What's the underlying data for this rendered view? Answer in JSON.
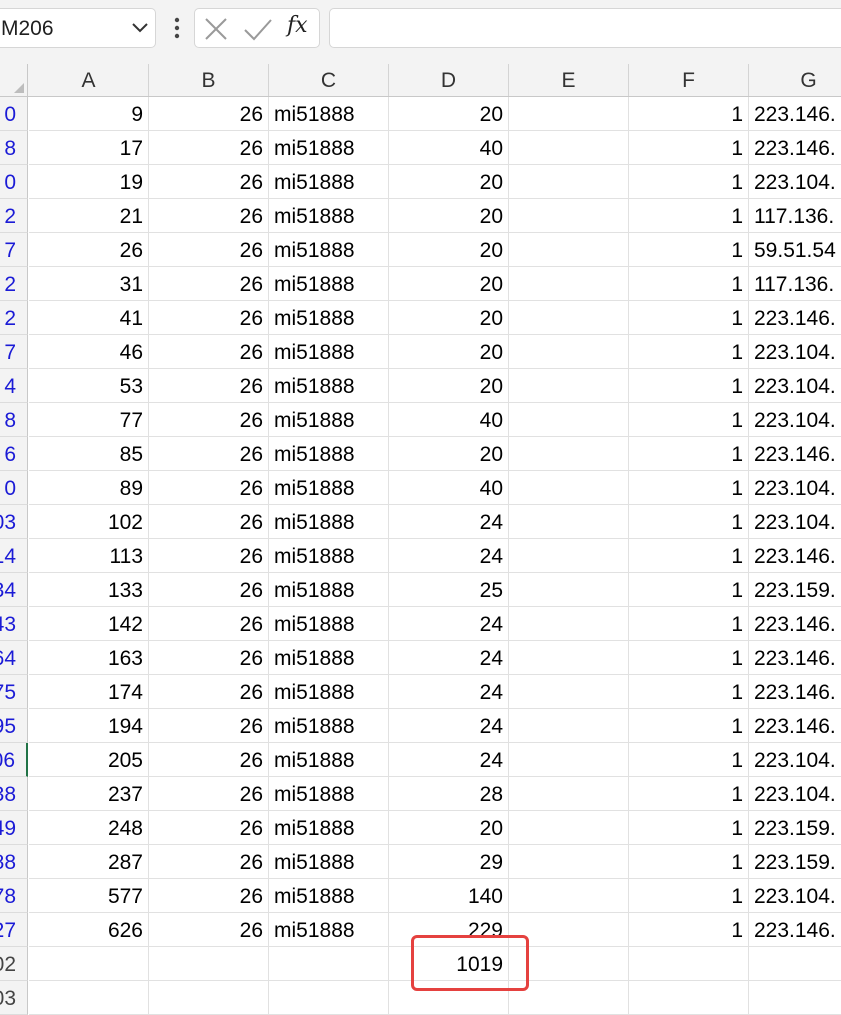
{
  "formula_bar": {
    "name_box": "M206",
    "formula_value": ""
  },
  "icons": {
    "cancel": "close-icon",
    "enter": "check-icon",
    "function": "fx-icon",
    "more": "kebab-icon",
    "dropdown": "chevron-down-icon"
  },
  "accent_colors": {
    "row_number": "#1b1bd6",
    "highlight": "#e5413f",
    "active_row_marker": "#217346"
  },
  "columns": [
    "A",
    "B",
    "C",
    "D",
    "E",
    "F",
    "G"
  ],
  "rows": [
    {
      "row": "0",
      "A": "9",
      "B": "26",
      "C": "mi51888",
      "D": "20",
      "E": "",
      "F": "1",
      "G": "223.146."
    },
    {
      "row": "8",
      "A": "17",
      "B": "26",
      "C": "mi51888",
      "D": "40",
      "E": "",
      "F": "1",
      "G": "223.146."
    },
    {
      "row": "0",
      "A": "19",
      "B": "26",
      "C": "mi51888",
      "D": "20",
      "E": "",
      "F": "1",
      "G": "223.104."
    },
    {
      "row": "2",
      "A": "21",
      "B": "26",
      "C": "mi51888",
      "D": "20",
      "E": "",
      "F": "1",
      "G": "117.136."
    },
    {
      "row": "7",
      "A": "26",
      "B": "26",
      "C": "mi51888",
      "D": "20",
      "E": "",
      "F": "1",
      "G": "59.51.54"
    },
    {
      "row": "2",
      "A": "31",
      "B": "26",
      "C": "mi51888",
      "D": "20",
      "E": "",
      "F": "1",
      "G": "117.136."
    },
    {
      "row": "2",
      "A": "41",
      "B": "26",
      "C": "mi51888",
      "D": "20",
      "E": "",
      "F": "1",
      "G": "223.146."
    },
    {
      "row": "7",
      "A": "46",
      "B": "26",
      "C": "mi51888",
      "D": "20",
      "E": "",
      "F": "1",
      "G": "223.104."
    },
    {
      "row": "4",
      "A": "53",
      "B": "26",
      "C": "mi51888",
      "D": "20",
      "E": "",
      "F": "1",
      "G": "223.104."
    },
    {
      "row": "8",
      "A": "77",
      "B": "26",
      "C": "mi51888",
      "D": "40",
      "E": "",
      "F": "1",
      "G": "223.104."
    },
    {
      "row": "6",
      "A": "85",
      "B": "26",
      "C": "mi51888",
      "D": "20",
      "E": "",
      "F": "1",
      "G": "223.146."
    },
    {
      "row": "0",
      "A": "89",
      "B": "26",
      "C": "mi51888",
      "D": "40",
      "E": "",
      "F": "1",
      "G": "223.104."
    },
    {
      "row": "03",
      "A": "102",
      "B": "26",
      "C": "mi51888",
      "D": "24",
      "E": "",
      "F": "1",
      "G": "223.104."
    },
    {
      "row": "14",
      "A": "113",
      "B": "26",
      "C": "mi51888",
      "D": "24",
      "E": "",
      "F": "1",
      "G": "223.146."
    },
    {
      "row": "34",
      "A": "133",
      "B": "26",
      "C": "mi51888",
      "D": "25",
      "E": "",
      "F": "1",
      "G": "223.159."
    },
    {
      "row": "43",
      "A": "142",
      "B": "26",
      "C": "mi51888",
      "D": "24",
      "E": "",
      "F": "1",
      "G": "223.146."
    },
    {
      "row": "64",
      "A": "163",
      "B": "26",
      "C": "mi51888",
      "D": "24",
      "E": "",
      "F": "1",
      "G": "223.146."
    },
    {
      "row": "75",
      "A": "174",
      "B": "26",
      "C": "mi51888",
      "D": "24",
      "E": "",
      "F": "1",
      "G": "223.146."
    },
    {
      "row": "95",
      "A": "194",
      "B": "26",
      "C": "mi51888",
      "D": "24",
      "E": "",
      "F": "1",
      "G": "223.146."
    },
    {
      "row": "06",
      "A": "205",
      "B": "26",
      "C": "mi51888",
      "D": "24",
      "E": "",
      "F": "1",
      "G": "223.104.",
      "active": true
    },
    {
      "row": "38",
      "A": "237",
      "B": "26",
      "C": "mi51888",
      "D": "28",
      "E": "",
      "F": "1",
      "G": "223.104."
    },
    {
      "row": "49",
      "A": "248",
      "B": "26",
      "C": "mi51888",
      "D": "20",
      "E": "",
      "F": "1",
      "G": "223.159."
    },
    {
      "row": "88",
      "A": "287",
      "B": "26",
      "C": "mi51888",
      "D": "29",
      "E": "",
      "F": "1",
      "G": "223.159."
    },
    {
      "row": "78",
      "A": "577",
      "B": "26",
      "C": "mi51888",
      "D": "140",
      "E": "",
      "F": "1",
      "G": "223.104."
    },
    {
      "row": "27",
      "A": "626",
      "B": "26",
      "C": "mi51888",
      "D": "229",
      "E": "",
      "F": "1",
      "G": "223.146."
    },
    {
      "row": "02",
      "A": "",
      "B": "",
      "C": "",
      "D": "1019",
      "E": "",
      "F": "",
      "G": "",
      "plain": true
    },
    {
      "row": "03",
      "A": "",
      "B": "",
      "C": "",
      "D": "",
      "E": "",
      "F": "",
      "G": "",
      "plain": true
    }
  ]
}
